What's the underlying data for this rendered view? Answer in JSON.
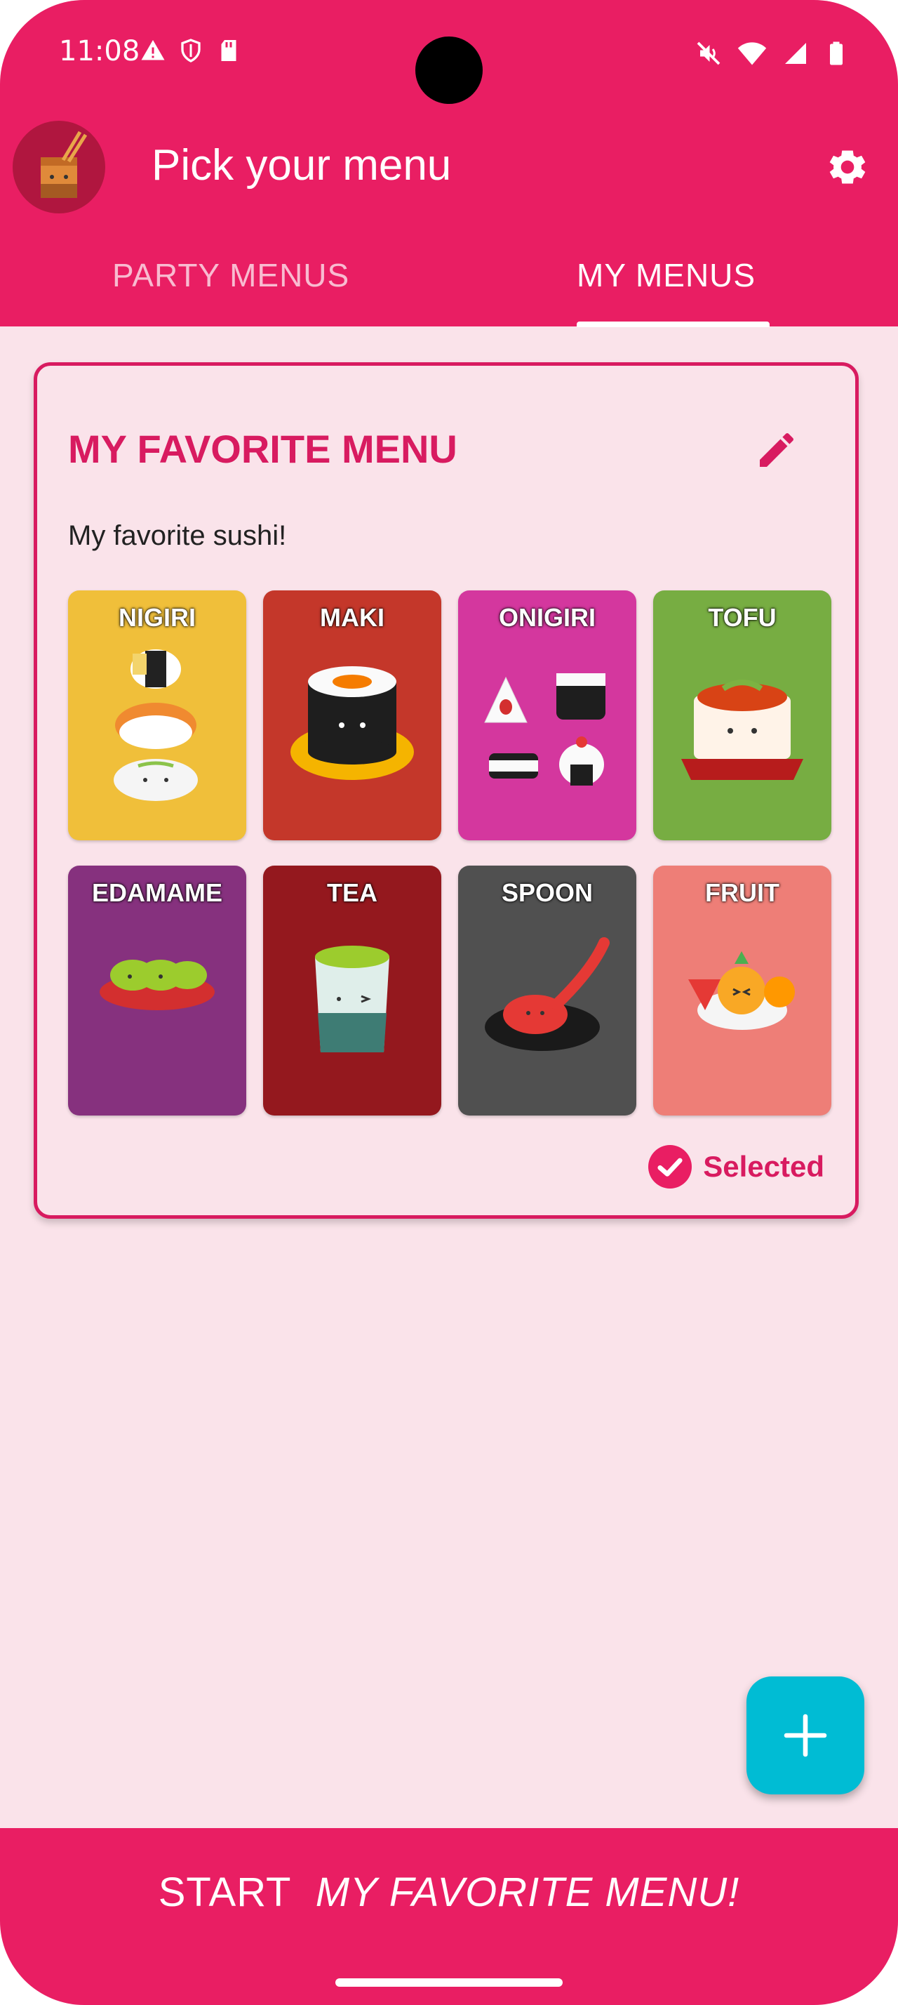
{
  "status_bar": {
    "time": "11:08",
    "left_icons": [
      "warning-icon",
      "shield-icon",
      "sd-card-icon"
    ],
    "right_icons": [
      "mute-icon",
      "wifi-icon",
      "signal-icon",
      "battery-icon"
    ]
  },
  "app_bar": {
    "title": "Pick your menu",
    "avatar_icon": "chopsticks-cup-icon",
    "settings_icon": "gear-icon"
  },
  "tabs": [
    {
      "label": "PARTY MENUS",
      "selected": false
    },
    {
      "label": "MY MENUS",
      "selected": true
    }
  ],
  "menu_card": {
    "title": "MY FAVORITE MENU",
    "description": "My favorite sushi!",
    "edit_icon": "pencil-icon",
    "selected_label": "Selected",
    "items": [
      {
        "label": "NIGIRI",
        "color": "#f0bf3a",
        "icon": "nigiri-icon"
      },
      {
        "label": "MAKI",
        "color": "#c4372a",
        "icon": "maki-icon"
      },
      {
        "label": "ONIGIRI",
        "color": "#d4379e",
        "icon": "onigiri-icon"
      },
      {
        "label": "TOFU",
        "color": "#77ad42",
        "icon": "tofu-icon"
      },
      {
        "label": "EDAMAME",
        "color": "#86317e",
        "icon": "edamame-icon"
      },
      {
        "label": "TEA",
        "color": "#94181e",
        "icon": "tea-cup-icon"
      },
      {
        "label": "SPOON",
        "color": "#505050",
        "icon": "spoon-icon"
      },
      {
        "label": "FRUIT",
        "color": "#ee7e77",
        "icon": "fruit-icon"
      }
    ]
  },
  "fab": {
    "icon": "plus-icon"
  },
  "bottom_bar": {
    "start_label": "START",
    "start_menu_name": "MY FAVORITE MENU!"
  },
  "colors": {
    "primary": "#e91e63",
    "accent_text": "#d81b60",
    "background": "#fae3ea",
    "fab": "#00bcd4"
  }
}
